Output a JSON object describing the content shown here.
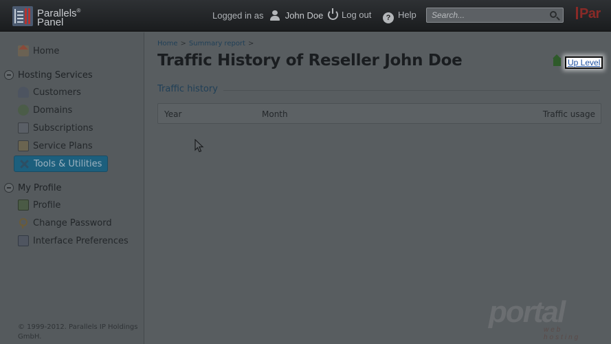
{
  "header": {
    "logo_line1": "Parallels",
    "logo_reg": "®",
    "logo_line2": "Panel",
    "logged_in_label": "Logged in as",
    "user_name": "John Doe",
    "logout_label": "Log out",
    "help_label": "Help",
    "help_glyph": "?",
    "search_placeholder": "Search...",
    "brand_corner": "Par"
  },
  "sidebar": {
    "home": "Home",
    "hosting_services": {
      "title": "Hosting Services",
      "items": [
        "Customers",
        "Domains",
        "Subscriptions",
        "Service Plans",
        "Tools & Utilities"
      ]
    },
    "my_profile": {
      "title": "My Profile",
      "items": [
        "Profile",
        "Change Password",
        "Interface Preferences"
      ]
    },
    "copyright": "© 1999-2012. Parallels IP Holdings GmbH."
  },
  "main": {
    "breadcrumbs": [
      "Home",
      "Summary report"
    ],
    "breadcrumb_sep": ">",
    "title": "Traffic History of Reseller John Doe",
    "up_level": "Up Level",
    "section_title": "Traffic history",
    "table_columns": [
      "Year",
      "Month",
      "Traffic usage"
    ]
  },
  "watermark": {
    "text": "portal",
    "sub": "web hosting"
  },
  "colors": {
    "topbar": "#1f2224",
    "background_dim": "#585d60",
    "active_nav": "#1c5f7d",
    "link": "#1d4fa0"
  }
}
